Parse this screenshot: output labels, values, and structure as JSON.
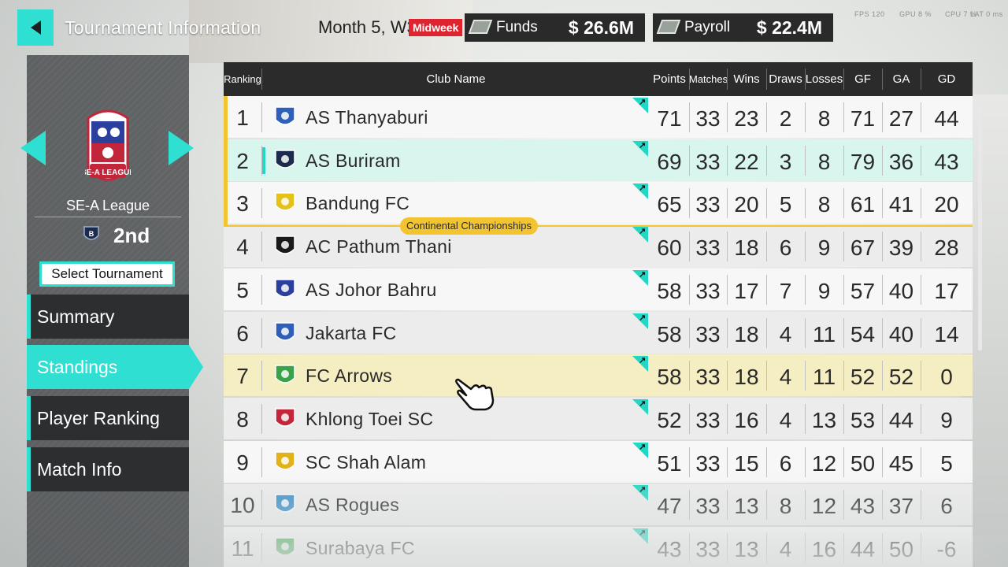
{
  "header": {
    "title": "Tournament Information",
    "month": "Month 5, W3",
    "midweek": "Midweek",
    "funds_label": "Funds",
    "funds_value": "$ 26.6M",
    "payroll_label": "Payroll",
    "payroll_value": "$ 22.4M",
    "perf": [
      "FPS 120",
      "GPU 8 %",
      "CPU 7 %",
      "LAT 0 ms"
    ]
  },
  "league": {
    "name": "SE-A League",
    "position": "2nd",
    "select_label": "Select Tournament",
    "badge_text": "SE-A LEAGUE"
  },
  "nav": [
    {
      "label": "Summary",
      "active": false
    },
    {
      "label": "Standings",
      "active": true
    },
    {
      "label": "Player Ranking",
      "active": false
    },
    {
      "label": "Match Info",
      "active": false
    }
  ],
  "table": {
    "columns": [
      "Ranking",
      "Club Name",
      "Points",
      "Matches",
      "Wins",
      "Draws",
      "Losses",
      "GF",
      "GA",
      "GD"
    ],
    "qualification_label": "Continental Championships",
    "rows": [
      {
        "rank": "1",
        "club": "AS Thanyaburi",
        "points": "71",
        "matches": "33",
        "wins": "23",
        "draws": "2",
        "losses": "8",
        "gf": "71",
        "ga": "27",
        "gd": "44",
        "logo_color": "#2f5fb8"
      },
      {
        "rank": "2",
        "club": "AS Buriram",
        "points": "69",
        "matches": "33",
        "wins": "22",
        "draws": "3",
        "losses": "8",
        "gf": "79",
        "ga": "36",
        "gd": "43",
        "logo_color": "#1c2b4d"
      },
      {
        "rank": "3",
        "club": "Bandung FC",
        "points": "65",
        "matches": "33",
        "wins": "20",
        "draws": "5",
        "losses": "8",
        "gf": "61",
        "ga": "41",
        "gd": "20",
        "logo_color": "#e5c21a"
      },
      {
        "rank": "4",
        "club": "AC Pathum Thani",
        "points": "60",
        "matches": "33",
        "wins": "18",
        "draws": "6",
        "losses": "9",
        "gf": "67",
        "ga": "39",
        "gd": "28",
        "logo_color": "#1a1a1a"
      },
      {
        "rank": "5",
        "club": "AS Johor Bahru",
        "points": "58",
        "matches": "33",
        "wins": "17",
        "draws": "7",
        "losses": "9",
        "gf": "57",
        "ga": "40",
        "gd": "17",
        "logo_color": "#2b3f9c"
      },
      {
        "rank": "6",
        "club": "Jakarta FC",
        "points": "58",
        "matches": "33",
        "wins": "18",
        "draws": "4",
        "losses": "11",
        "gf": "54",
        "ga": "40",
        "gd": "14",
        "logo_color": "#2f5fb8"
      },
      {
        "rank": "7",
        "club": "FC Arrows",
        "points": "58",
        "matches": "33",
        "wins": "18",
        "draws": "4",
        "losses": "11",
        "gf": "52",
        "ga": "52",
        "gd": "0",
        "logo_color": "#3aa34a"
      },
      {
        "rank": "8",
        "club": "Khlong Toei SC",
        "points": "52",
        "matches": "33",
        "wins": "16",
        "draws": "4",
        "losses": "13",
        "gf": "53",
        "ga": "44",
        "gd": "9",
        "logo_color": "#c2263a"
      },
      {
        "rank": "9",
        "club": "SC Shah Alam",
        "points": "51",
        "matches": "33",
        "wins": "15",
        "draws": "6",
        "losses": "12",
        "gf": "50",
        "ga": "45",
        "gd": "5",
        "logo_color": "#e2b21a"
      },
      {
        "rank": "10",
        "club": "AS Rogues",
        "points": "47",
        "matches": "33",
        "wins": "13",
        "draws": "8",
        "losses": "12",
        "gf": "43",
        "ga": "37",
        "gd": "6",
        "logo_color": "#3a8fc8"
      },
      {
        "rank": "11",
        "club": "Surabaya FC",
        "points": "43",
        "matches": "33",
        "wins": "13",
        "draws": "4",
        "losses": "16",
        "gf": "44",
        "ga": "50",
        "gd": "-6",
        "logo_color": "#3aa34a"
      }
    ]
  },
  "colors": {
    "accent": "#2fe0d2",
    "highlight_own_club": "#d8f5ee",
    "highlight_selected": "#f5eec2",
    "qualification": "#f2c530",
    "midweek": "#e0242f"
  }
}
